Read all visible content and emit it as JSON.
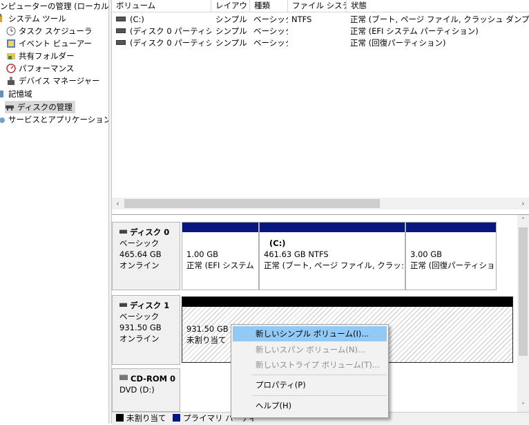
{
  "tree": {
    "items": [
      {
        "label": "ンピューターの管理 (ローカル)",
        "icon": "computer-management-icon"
      },
      {
        "label": "システム ツール",
        "icon": "tools-icon"
      },
      {
        "label": "タスク スケジューラ",
        "icon": "clock-icon"
      },
      {
        "label": "イベント ビューアー",
        "icon": "event-viewer-icon"
      },
      {
        "label": "共有フォルダー",
        "icon": "shared-folder-icon"
      },
      {
        "label": "パフォーマンス",
        "icon": "performance-icon"
      },
      {
        "label": "デバイス マネージャー",
        "icon": "device-manager-icon"
      },
      {
        "label": "記憶域",
        "icon": "storage-icon"
      },
      {
        "label": "ディスクの管理",
        "icon": "disk-management-icon",
        "selected": true
      },
      {
        "label": "サービスとアプリケーション",
        "icon": "services-icon"
      }
    ]
  },
  "volume_list": {
    "columns": [
      "ボリューム",
      "レイアウト",
      "種類",
      "ファイル システム",
      "状態"
    ],
    "rows": [
      [
        "(C:)",
        "シンプル",
        "ベーシック",
        "NTFS",
        "正常 (ブート, ページ ファイル, クラッシュ ダンプ, ベーシック デ"
      ],
      [
        "(ディスク 0 パーティション 1)",
        "シンプル",
        "ベーシック",
        "",
        "正常 (EFI システム パーティション)"
      ],
      [
        "(ディスク 0 パーティション 4)",
        "シンプル",
        "ベーシック",
        "",
        "正常 (回復パーティション)"
      ]
    ]
  },
  "disks": [
    {
      "name": "ディスク 0",
      "type": "ベーシック",
      "size": "465.64 GB",
      "status": "オンライン",
      "partitions": [
        {
          "line1": "",
          "line2": "1.00 GB",
          "line3": "正常 (EFI システム パ"
        },
        {
          "line1": "(C:)",
          "line2": "461.63 GB NTFS",
          "line3": "正常 (ブート, ページ ファイル, クラッシュ ダンプ"
        },
        {
          "line1": "",
          "line2": "3.00 GB",
          "line3": "正常 (回復パーティション)"
        }
      ]
    },
    {
      "name": "ディスク 1",
      "type": "ベーシック",
      "size": "931.50 GB",
      "status": "オンライン",
      "partitions": [
        {
          "line1": "931.50 GB",
          "line2": "未割り当て"
        }
      ]
    },
    {
      "name": "CD-ROM 0",
      "type": "DVD (D:)"
    }
  ],
  "legend": [
    {
      "label": "未割り当て",
      "color": "#000000"
    },
    {
      "label": "プライマリ パーティ",
      "color": "#0a167f"
    }
  ],
  "context_menu": {
    "items": [
      {
        "label": "新しいシンプル ボリューム(I)...",
        "state": "highlighted"
      },
      {
        "label": "新しいスパン ボリューム(N)...",
        "state": "disabled"
      },
      {
        "label": "新しいストライプ ボリューム(T)...",
        "state": "disabled"
      },
      {
        "label": "プロパティ(P)",
        "state": "enabled"
      },
      {
        "label": "ヘルプ(H)",
        "state": "enabled"
      }
    ]
  },
  "colors": {
    "primary_partition": "#0a167f",
    "unallocated": "#000000",
    "menu_highlight": "#91c9f7"
  }
}
